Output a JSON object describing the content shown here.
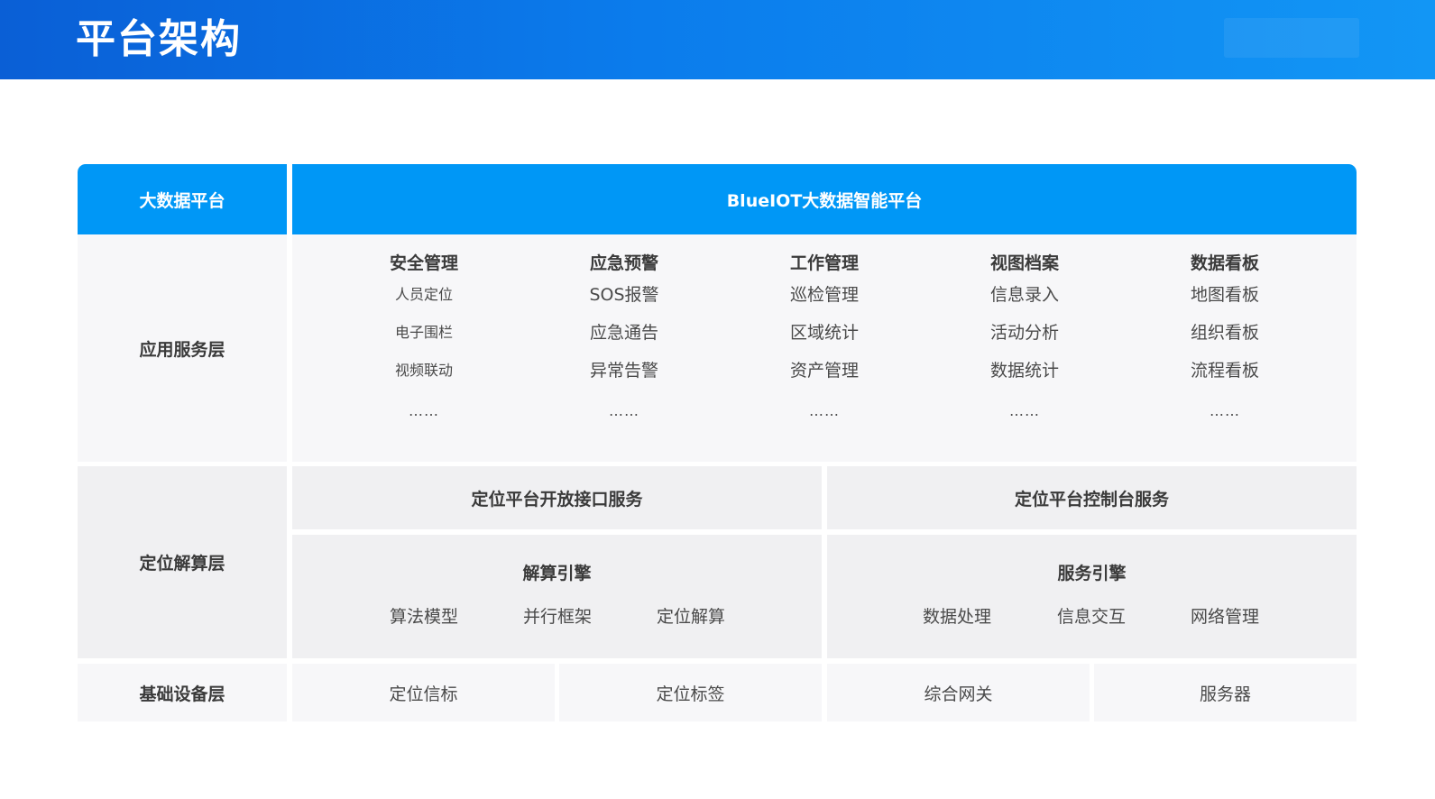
{
  "header": {
    "title": "平台架构"
  },
  "platform": {
    "label": "大数据平台",
    "name": "BlueIOT大数据智能平台"
  },
  "app_layer": {
    "label": "应用服务层",
    "columns": [
      {
        "title": "安全管理",
        "items": [
          "人员定位",
          "电子围栏",
          "视频联动"
        ],
        "more": "……"
      },
      {
        "title": "应急预警",
        "items": [
          "SOS报警",
          "应急通告",
          "异常告警"
        ],
        "more": "……"
      },
      {
        "title": "工作管理",
        "items": [
          "巡检管理",
          "区域统计",
          "资产管理"
        ],
        "more": "……"
      },
      {
        "title": "视图档案",
        "items": [
          "信息录入",
          "活动分析",
          "数据统计"
        ],
        "more": "……"
      },
      {
        "title": "数据看板",
        "items": [
          "地图看板",
          "组织看板",
          "流程看板"
        ],
        "more": "……"
      }
    ]
  },
  "calc_layer": {
    "label": "定位解算层",
    "open_api": "定位平台开放接口服务",
    "console": "定位平台控制台服务",
    "solver_engine": {
      "title": "解算引擎",
      "items": [
        "算法模型",
        "并行框架",
        "定位解算"
      ]
    },
    "service_engine": {
      "title": "服务引擎",
      "items": [
        "数据处理",
        "信息交互",
        "网络管理"
      ]
    }
  },
  "device_layer": {
    "label": "基础设备层",
    "items": [
      "定位信标",
      "定位标签",
      "综合网关",
      "服务器"
    ]
  }
}
